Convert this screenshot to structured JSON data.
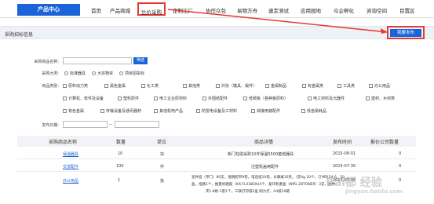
{
  "nav": {
    "brand": "产品中心",
    "items": [
      "首页",
      "产品商城",
      "比价采购",
      "定制工厂",
      "协作众包",
      "易物方舟",
      "速定测试",
      "应用园地",
      "众企孵化",
      "咨询空间",
      "目置区"
    ]
  },
  "crumb": {
    "title": "采购招标信息",
    "publish": "我要发布"
  },
  "form": {
    "name_label": "采购商品名称:",
    "search_button": "筛选",
    "type_label": "采购大类:",
    "type_options": [
      "标准器具",
      "大宗物资",
      "项目招投标"
    ],
    "category_label": "商品类别:",
    "category_rows": [
      [
        "原料动力类",
        "黑色金属",
        "化工类",
        "其他类",
        "外协（模具、锻件）",
        "金属制品",
        "有金属类",
        "工具类",
        "办公用品"
      ],
      [
        "计算机、软件及设备",
        "塑料原件",
        "电工企业原材料",
        "外围结配件",
        "低频板（各种板原料）",
        "电工材料及元器件",
        "建材、木材类"
      ],
      [
        "有色金属",
        "传输设备及通讯器材",
        "其他机电产品",
        "防雷电设备及工材料",
        "焊接用装配件",
        "低值易耗品"
      ]
    ],
    "date_label": "发布日期:",
    "date_separator": "--"
  },
  "table": {
    "headers": [
      "采购商品名称",
      "数量",
      "单位",
      "商品详情",
      "发布时间",
      "报价公司数量"
    ],
    "rows": [
      {
        "name": "保温器具",
        "qty": "10",
        "unit": "块",
        "detail": "新门柱缆采购10件保温5500套缆器具",
        "date": "2015-08-01",
        "count": "0"
      },
      {
        "name": "交流配件",
        "qty": "100",
        "unit": "件",
        "detail": "注塑机盖两配件",
        "date": "2015-07-30",
        "count": "0"
      },
      {
        "name": "办公用品",
        "qty": "1",
        "unit": "批",
        "date": "2015-07-30",
        "count": "0",
        "detail_lines": [
          "宽件宿（带门）80支，透明胶带9卷，电话纸10卷，长摩尾10夹，（普4g 20个，订书针24-6，50",
          "盒，指路1个，推夏机硒鼓（KX-FL338CN)4个，复印机墨盒（NPG-28TONER）3支，文件",
          "夹1.8格-1套1个，三联打印纸2盒 刷力打，A4纸10箱"
        ]
      }
    ]
  },
  "watermark": "Bai都 经验",
  "watermark_sub": "jingyan.baidu.com",
  "colors": {
    "brand": "#1a63d8",
    "highlight": "#e53935",
    "link": "#1a63d8"
  }
}
